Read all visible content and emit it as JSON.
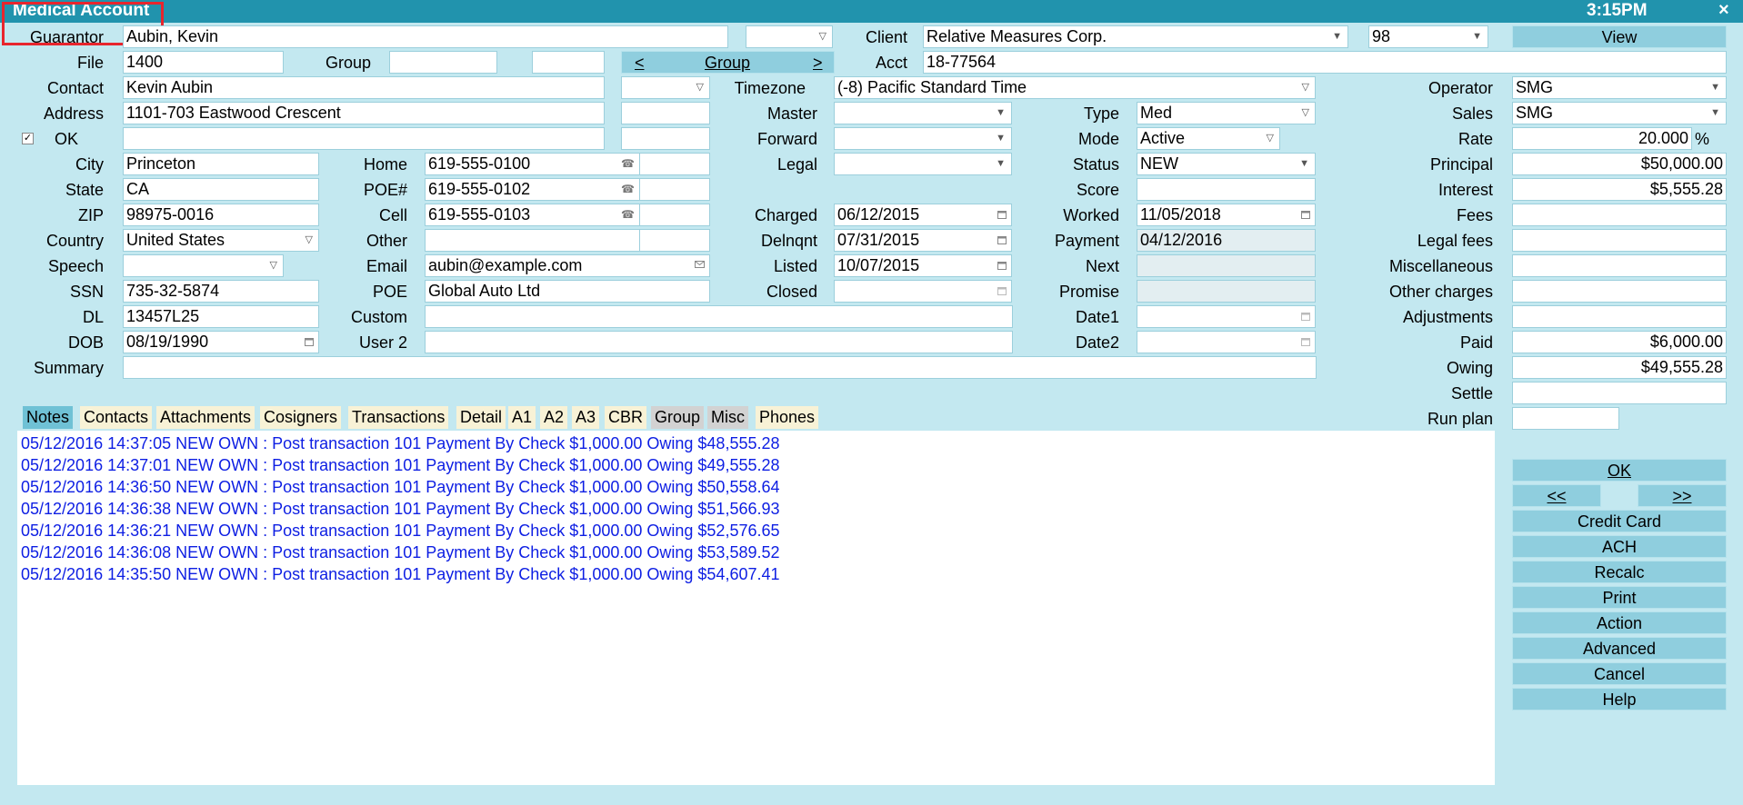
{
  "window": {
    "title": "Medical Account",
    "clock": "3:15PM",
    "close": "×"
  },
  "fields": {
    "guarantor": {
      "label": "Guarantor",
      "value": "Aubin, Kevin"
    },
    "guarantor_extra": {
      "value": ""
    },
    "client": {
      "label": "Client",
      "value": "Relative Measures Corp."
    },
    "client_code": {
      "value": "98"
    },
    "file": {
      "label": "File",
      "value": "1400"
    },
    "group": {
      "label": "Group",
      "value": "",
      "value2": ""
    },
    "acct": {
      "label": "Acct",
      "value": "18-77564"
    },
    "contact": {
      "label": "Contact",
      "value": "Kevin Aubin"
    },
    "contact_extra": {
      "value": ""
    },
    "timezone": {
      "label": "Timezone",
      "value": "(-8) Pacific Standard Time"
    },
    "operator": {
      "label": "Operator",
      "value": "SMG"
    },
    "address": {
      "label": "Address",
      "value": "1101-703 Eastwood Crescent"
    },
    "address_extra": {
      "value": ""
    },
    "master": {
      "label": "Master",
      "value": ""
    },
    "type": {
      "label": "Type",
      "value": "Med"
    },
    "sales": {
      "label": "Sales",
      "value": "SMG"
    },
    "ok": {
      "label": "OK",
      "checked": "✓",
      "value": ""
    },
    "ok_extra": {
      "value": ""
    },
    "forward": {
      "label": "Forward",
      "value": ""
    },
    "mode": {
      "label": "Mode",
      "value": "Active"
    },
    "rate": {
      "label": "Rate",
      "value": "20.000",
      "unit": "%"
    },
    "city": {
      "label": "City",
      "value": "Princeton"
    },
    "home": {
      "label": "Home",
      "value": "619-555-0100",
      "ext": ""
    },
    "legal": {
      "label": "Legal",
      "value": ""
    },
    "status": {
      "label": "Status",
      "value": "NEW"
    },
    "principal": {
      "label": "Principal",
      "value": "$50,000.00"
    },
    "state": {
      "label": "State",
      "value": "CA"
    },
    "poe_num": {
      "label": "POE#",
      "value": "619-555-0102",
      "ext": ""
    },
    "score": {
      "label": "Score",
      "value": ""
    },
    "interest": {
      "label": "Interest",
      "value": "$5,555.28"
    },
    "zip": {
      "label": "ZIP",
      "value": "98975-0016"
    },
    "cell": {
      "label": "Cell",
      "value": "619-555-0103",
      "ext": ""
    },
    "charged": {
      "label": "Charged",
      "value": "06/12/2015"
    },
    "worked": {
      "label": "Worked",
      "value": "11/05/2018"
    },
    "fees": {
      "label": "Fees",
      "value": ""
    },
    "country": {
      "label": "Country",
      "value": "United States"
    },
    "other": {
      "label": "Other",
      "value": "",
      "ext": ""
    },
    "delnqnt": {
      "label": "Delnqnt",
      "value": "07/31/2015"
    },
    "payment": {
      "label": "Payment",
      "value": "04/12/2016"
    },
    "legal_fees": {
      "label": "Legal fees",
      "value": ""
    },
    "speech": {
      "label": "Speech",
      "value": ""
    },
    "email": {
      "label": "Email",
      "value": "aubin@example.com"
    },
    "listed": {
      "label": "Listed",
      "value": "10/07/2015"
    },
    "next": {
      "label": "Next",
      "value": ""
    },
    "misc": {
      "label": "Miscellaneous",
      "value": ""
    },
    "ssn": {
      "label": "SSN",
      "value": "735-32-5874"
    },
    "poe": {
      "label": "POE",
      "value": "Global Auto Ltd"
    },
    "closed": {
      "label": "Closed",
      "value": ""
    },
    "promise": {
      "label": "Promise",
      "value": ""
    },
    "other_charges": {
      "label": "Other charges",
      "value": ""
    },
    "dl": {
      "label": "DL",
      "value": "13457L25"
    },
    "custom": {
      "label": "Custom",
      "value": ""
    },
    "date1": {
      "label": "Date1",
      "value": ""
    },
    "adjustments": {
      "label": "Adjustments",
      "value": ""
    },
    "dob": {
      "label": "DOB",
      "value": "08/19/1990"
    },
    "user2": {
      "label": "User 2",
      "value": ""
    },
    "date2": {
      "label": "Date2",
      "value": ""
    },
    "paid": {
      "label": "Paid",
      "value": "$6,000.00"
    },
    "summary": {
      "label": "Summary",
      "value": ""
    },
    "owing": {
      "label": "Owing",
      "value": "$49,555.28"
    },
    "settle": {
      "label": "Settle",
      "value": ""
    },
    "run_plan": {
      "label": "Run plan",
      "value": ""
    }
  },
  "group_nav": {
    "prev": "<",
    "label": "Group",
    "next": ">"
  },
  "buttons": {
    "view": "View",
    "ok": "OK",
    "prev": "<<",
    "next": ">>",
    "credit_card": "Credit Card",
    "ach": "ACH",
    "recalc": "Recalc",
    "print": "Print",
    "action": "Action",
    "advanced": "Advanced",
    "cancel": "Cancel",
    "help": "Help"
  },
  "tabs": [
    "Notes",
    "Contacts",
    "Attachments",
    "Cosigners",
    "Transactions",
    "Detail",
    "A1",
    "A2",
    "A3",
    "CBR",
    "Group",
    "Misc",
    "Phones"
  ],
  "notes": [
    "05/12/2016 14:37:05 NEW OWN : Post transaction 101 Payment By Check $1,000.00 Owing $48,555.28",
    "05/12/2016 14:37:01 NEW OWN : Post transaction 101 Payment By Check $1,000.00 Owing $49,555.28",
    "05/12/2016 14:36:50 NEW OWN : Post transaction 101 Payment By Check $1,000.00 Owing $50,558.64",
    "05/12/2016 14:36:38 NEW OWN : Post transaction 101 Payment By Check $1,000.00 Owing $51,566.93",
    "05/12/2016 14:36:21 NEW OWN : Post transaction 101 Payment By Check $1,000.00 Owing $52,576.65",
    "05/12/2016 14:36:08 NEW OWN : Post transaction 101 Payment By Check $1,000.00 Owing $53,589.52",
    "05/12/2016 14:35:50 NEW OWN : Post transaction 101 Payment By Check $1,000.00 Owing $54,607.41"
  ],
  "colors": {
    "titlebar": "#2193ad",
    "background": "#c3e8f0",
    "button": "#8fcede",
    "note_text": "#0d1ee3",
    "highlight_box": "#e8252d"
  }
}
